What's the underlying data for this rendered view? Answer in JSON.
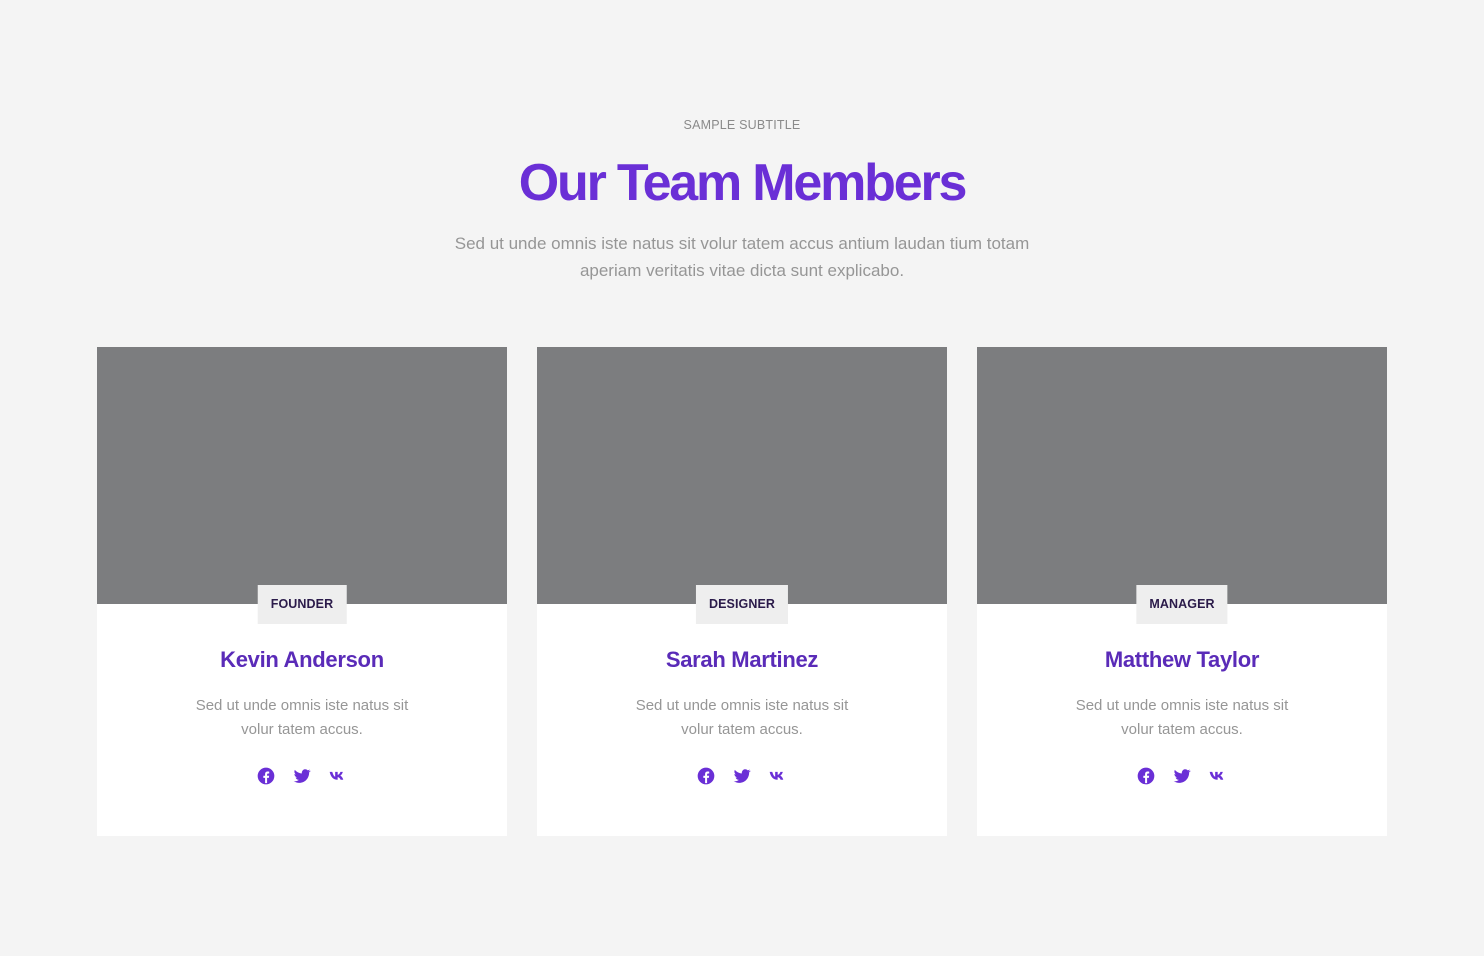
{
  "header": {
    "subtitle": "SAMPLE SUBTITLE",
    "title": "Our Team Members",
    "intro": "Sed ut unde omnis iste natus sit volur tatem accus antium laudan tium totam aperiam veritatis vitae dicta sunt explicabo."
  },
  "members": [
    {
      "role": "FOUNDER",
      "name": "Kevin Anderson",
      "bio": "Sed ut unde omnis iste natus sit volur tatem accus."
    },
    {
      "role": "DESIGNER",
      "name": "Sarah Martinez",
      "bio": "Sed ut unde omnis iste natus sit volur tatem accus."
    },
    {
      "role": "MANAGER",
      "name": "Matthew Taylor",
      "bio": "Sed ut unde omnis iste natus sit volur tatem accus."
    }
  ],
  "social_icons": [
    "facebook-icon",
    "twitter-icon",
    "vk-icon"
  ],
  "colors": {
    "accent": "#6a2fd6",
    "background": "#f4f4f4",
    "photo_placeholder": "#7c7d7f"
  }
}
